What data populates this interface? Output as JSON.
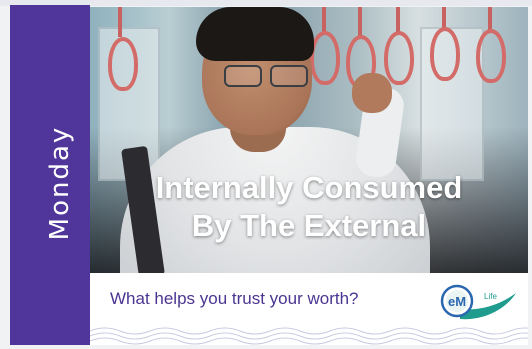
{
  "sidebar": {
    "day": "Monday"
  },
  "hero": {
    "headline_line1": "Internally Consumed",
    "headline_line2": "By The External"
  },
  "footer": {
    "question": "What helps you trust your worth?"
  },
  "logo": {
    "main": "eM",
    "sub": "Life"
  },
  "colors": {
    "brand_purple": "#50359a",
    "question_text": "#4b3592",
    "logo_teal": "#1f9c8e",
    "logo_blue": "#2a67b1"
  }
}
